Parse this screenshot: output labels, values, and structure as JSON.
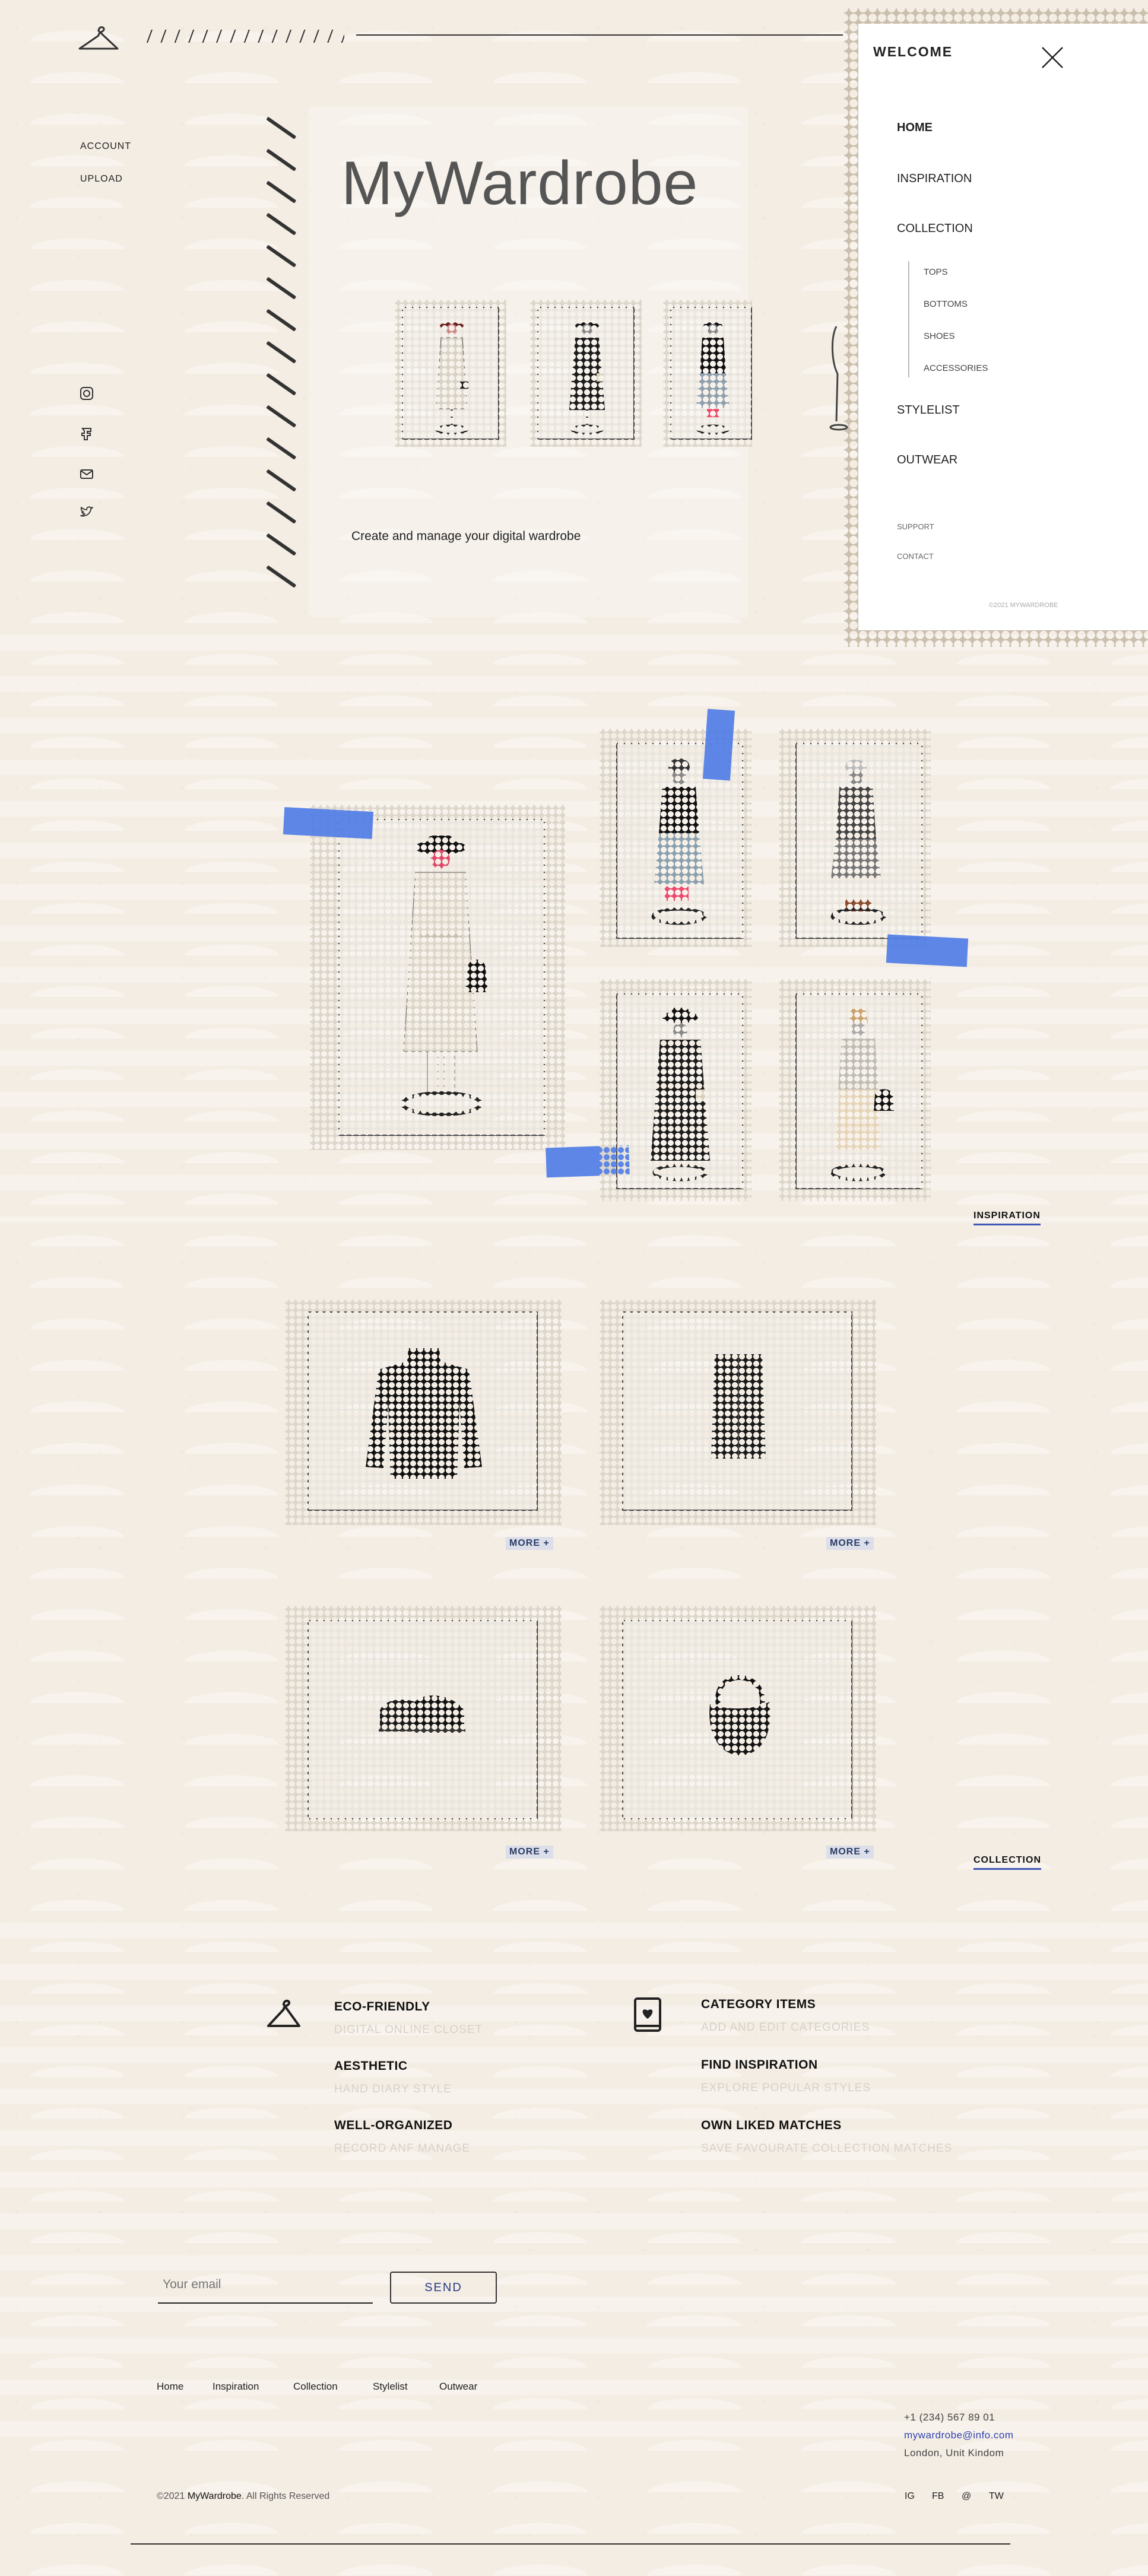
{
  "header": {
    "account": "ACCOUNT",
    "upload": "UPLOAD"
  },
  "hero": {
    "title": "MyWardrobe",
    "tagline": "Create and manage your digital wardrobe"
  },
  "drawer": {
    "title": "WELCOME",
    "nav": [
      "HOME",
      "INSPIRATION",
      "COLLECTION",
      "STYLELIST",
      "OUTWEAR"
    ],
    "sub": [
      "TOPS",
      "BOTTOMS",
      "SHOES",
      "ACCESSORIES"
    ],
    "support": "SUPPORT",
    "contact": "CONTACT",
    "copyright": "©2021 MYWARDROBE"
  },
  "inspiration": {
    "link": "INSPIRATION"
  },
  "collection": {
    "link": "COLLECTION",
    "more": "MORE +",
    "items": [
      "knit-sweater",
      "leather-skirt",
      "loafers",
      "leather-bag"
    ]
  },
  "features": {
    "left": [
      {
        "title": "ECO-FRIENDLY",
        "sub": "DIGITAL ONLINE CLOSET"
      },
      {
        "title": "AESTHETIC",
        "sub": "HAND DIARY STYLE"
      },
      {
        "title": "WELL-ORGANIZED",
        "sub": "RECORD ANF MANAGE"
      }
    ],
    "right": [
      {
        "title": "CATEGORY ITEMS",
        "sub": "ADD AND EDIT CATEGORIES"
      },
      {
        "title": "FIND INSPIRATION",
        "sub": "EXPLORE POPULAR STYLES"
      },
      {
        "title": "OWN LIKED MATCHES",
        "sub": "SAVE FAVOURATE COLLECTION MATCHES"
      }
    ]
  },
  "newsletter": {
    "placeholder": "Your email",
    "send": "SEND"
  },
  "footer": {
    "nav": [
      "Home",
      "Inspiration",
      "Collection",
      "Stylelist",
      "Outwear"
    ],
    "phone": "+1 (234) 567 89 01",
    "email": "mywardrobe@info.com",
    "address": "London, Unit Kindom",
    "copy_pre": "©2021 ",
    "brand": "MyWardrobe",
    "copy_post": ". All Rights Reserved",
    "social": [
      "IG",
      "FB",
      "@",
      "TW"
    ]
  },
  "colors": {
    "accent": "#4f7de6",
    "underline": "#4055b8",
    "bg": "#f4ede4"
  }
}
